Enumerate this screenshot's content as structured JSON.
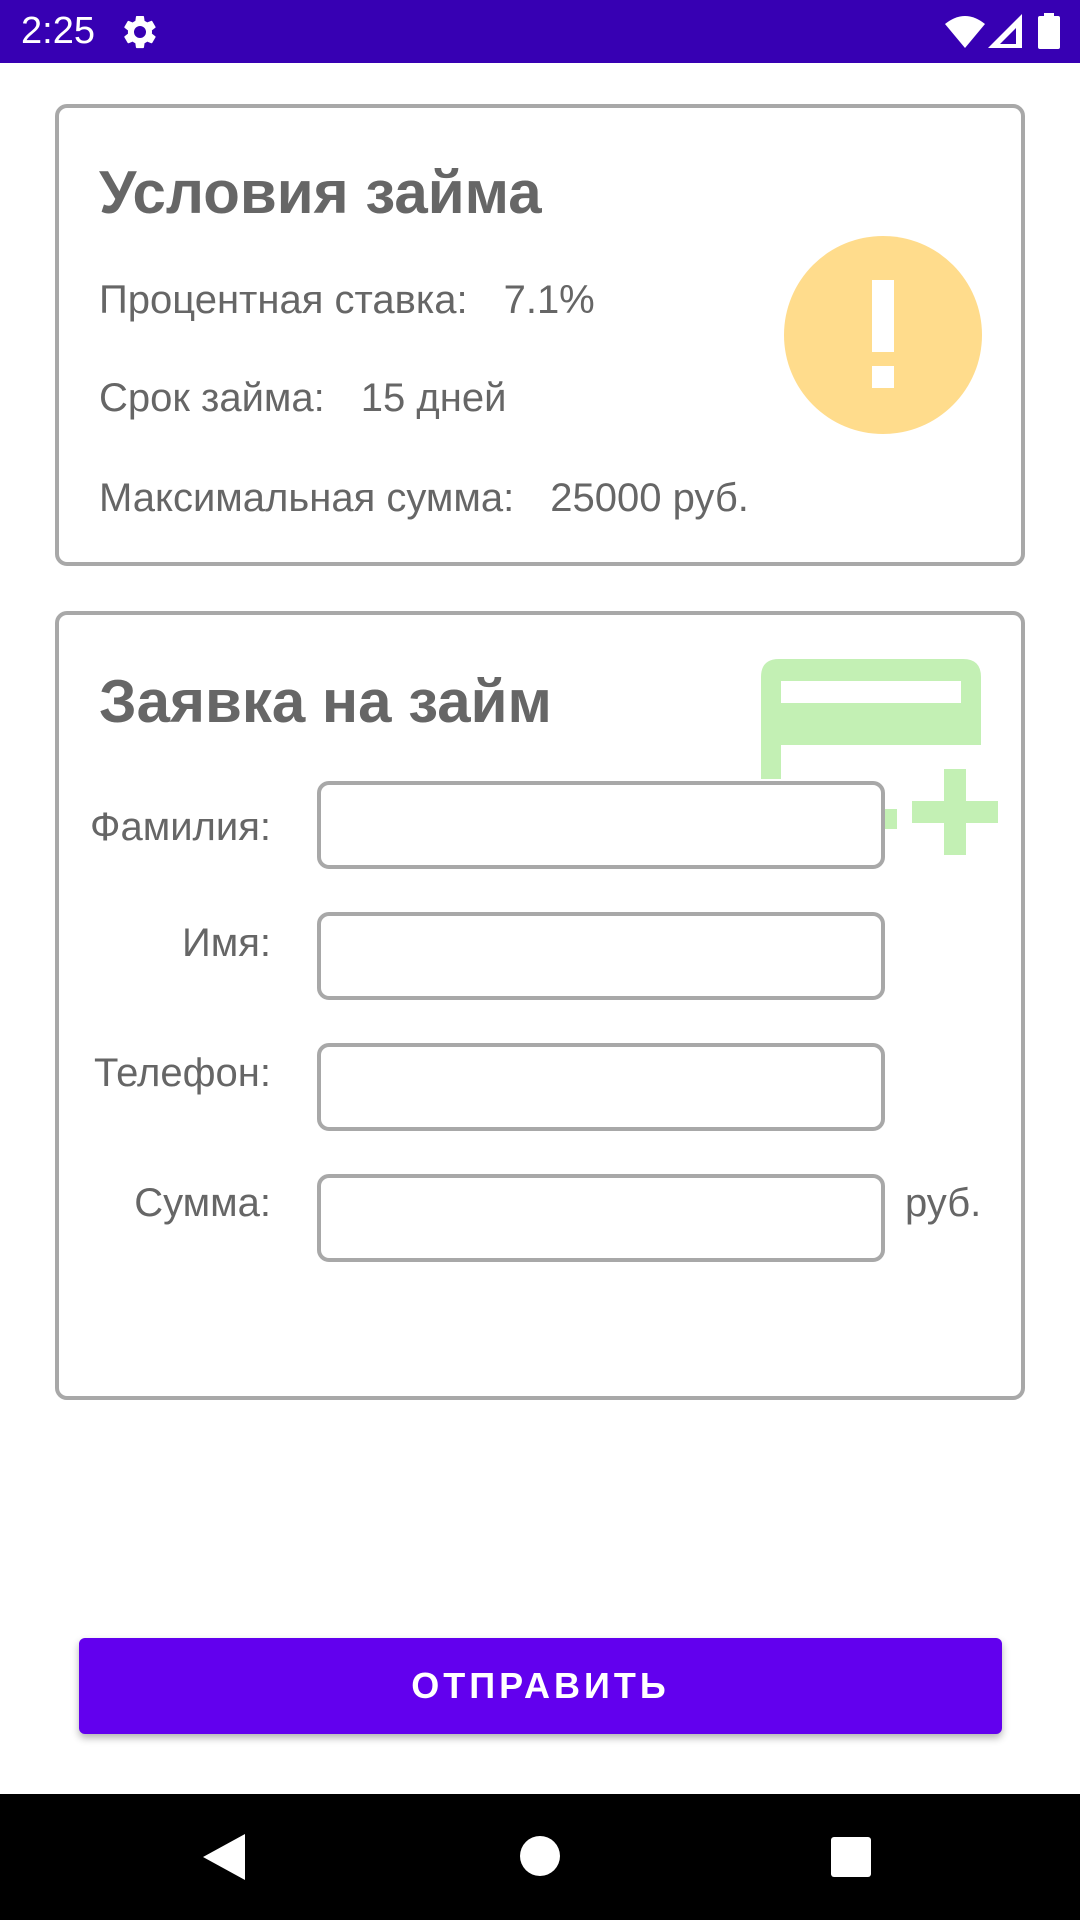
{
  "status_bar": {
    "time": "2:25",
    "icons": [
      "gear-icon",
      "wifi-icon",
      "signal-icon",
      "battery-icon"
    ],
    "background": "#3700b3"
  },
  "loan_terms": {
    "title": "Условия займа",
    "rate_label": "Процентная ставка:",
    "rate_value": "7.1%",
    "term_label": "Срок займа:",
    "term_value": "15 дней",
    "max_label": "Максимальная сумма:",
    "max_value": "25000 руб.",
    "icon": "warning-icon",
    "icon_color": "#ffdc8c"
  },
  "loan_form": {
    "title": "Заявка на займ",
    "icon": "add-card-icon",
    "icon_color": "#c3f0b4",
    "fields": [
      {
        "label": "Фамилия:",
        "value": "",
        "placeholder": ""
      },
      {
        "label": "Имя:",
        "value": "",
        "placeholder": ""
      },
      {
        "label": "Телефон:",
        "value": "",
        "placeholder": ""
      },
      {
        "label": "Сумма:",
        "value": "",
        "placeholder": ""
      }
    ],
    "sum_unit": "руб."
  },
  "submit": {
    "label": "ОТПРАВИТЬ",
    "color": "#6200ee"
  },
  "nav_bar": {
    "icons": [
      "back-icon",
      "home-icon",
      "recents-icon"
    ]
  }
}
